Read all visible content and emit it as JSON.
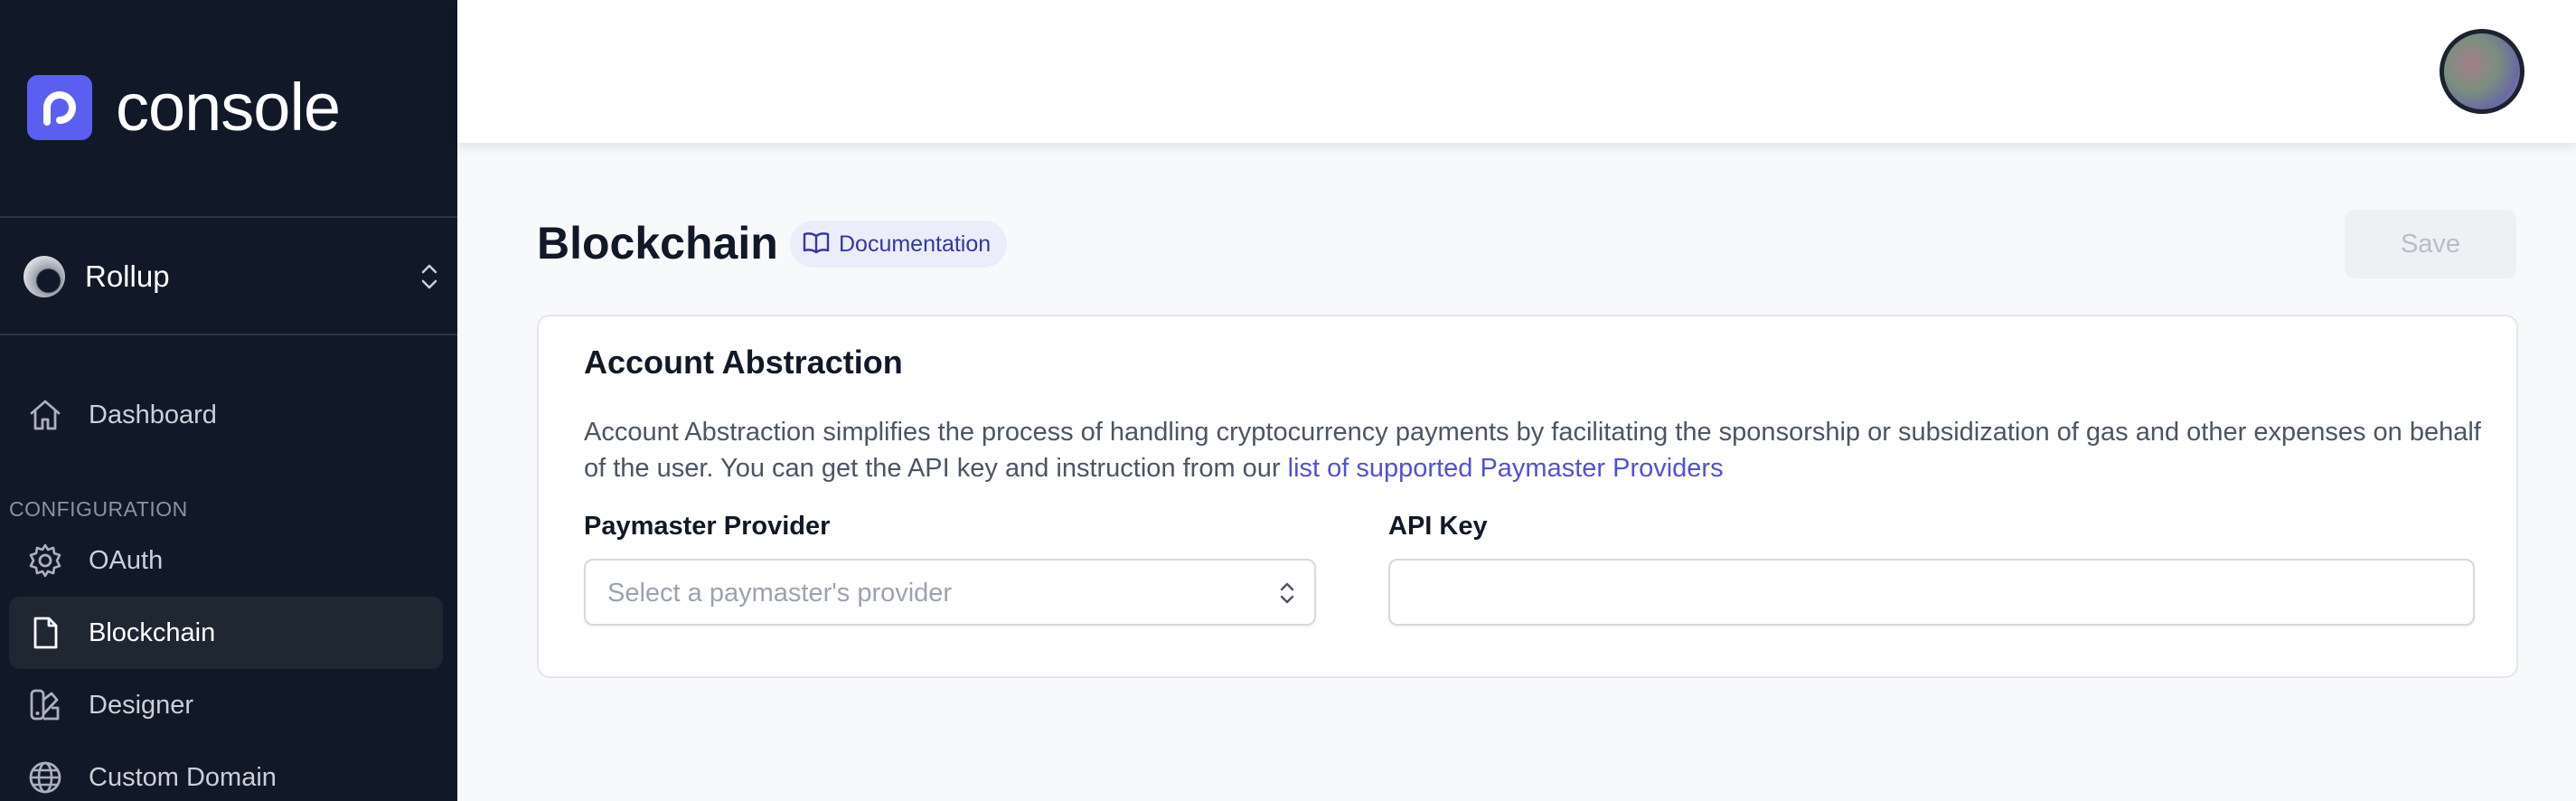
{
  "brand": {
    "name": "console",
    "logo_icon": "console-logo-icon",
    "accent": "#5b5ff0"
  },
  "project": {
    "name": "Rollup"
  },
  "nav": {
    "dashboard": "Dashboard",
    "section_label": "CONFIGURATION",
    "items": [
      {
        "label": "OAuth",
        "icon": "gear-icon"
      },
      {
        "label": "Blockchain",
        "icon": "file-icon",
        "active": true
      },
      {
        "label": "Designer",
        "icon": "palette-icon"
      },
      {
        "label": "Custom Domain",
        "icon": "globe-icon"
      }
    ]
  },
  "page": {
    "title": "Blockchain",
    "doc_label": "Documentation",
    "save_label": "Save"
  },
  "card": {
    "title": "Account Abstraction",
    "description": "Account Abstraction simplifies the process of handling cryptocurrency payments by facilitating the sponsorship or subsidization of gas and other expenses on behalf of the user. You can get the API key and instruction from our ",
    "link_text": "list of supported Paymaster Providers",
    "provider_label": "Paymaster Provider",
    "provider_placeholder": "Select a paymaster's provider",
    "apikey_label": "API Key",
    "apikey_value": ""
  }
}
